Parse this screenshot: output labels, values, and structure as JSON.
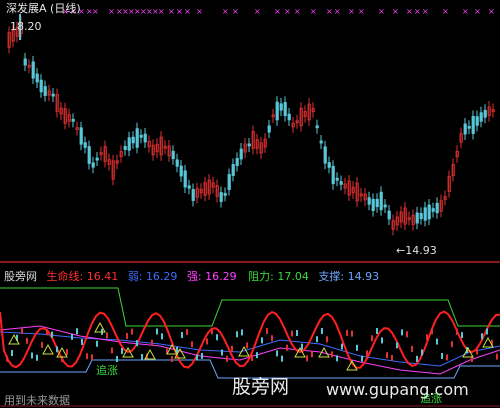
{
  "title": "深发展A (日线)",
  "price_labels": {
    "high": "18.20",
    "low": "←14.93"
  },
  "indicator": {
    "name": "股旁网",
    "items": [
      {
        "label": "生命线:",
        "value": "16.41",
        "color": "#ff3030"
      },
      {
        "label": "弱:",
        "value": "16.29",
        "color": "#3a6cff"
      },
      {
        "label": "强:",
        "value": "16.29",
        "color": "#ff40ff"
      },
      {
        "label": "阻力:",
        "value": "17.04",
        "color": "#3ad83a"
      },
      {
        "label": "支撑:",
        "value": "14.93",
        "color": "#6aa8ff"
      }
    ]
  },
  "tags": {
    "chase1": "追涨",
    "chase2": "追涨"
  },
  "watermarks": {
    "site": "股旁网",
    "url": "www.gupang.com",
    "note": "用到未来数据"
  },
  "colors": {
    "up": "#e03030",
    "down": "#58c8d8",
    "grid": "#8a1a1a",
    "marker": "#ff40ff"
  }
}
